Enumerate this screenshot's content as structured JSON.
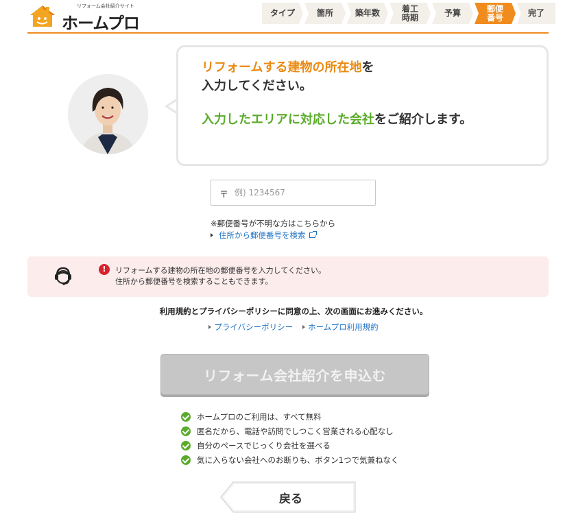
{
  "header": {
    "logo_tagline": "リフォーム会社紹介サイト",
    "logo_text": "ホームプロ",
    "steps": [
      {
        "label": "タイプ",
        "active": false
      },
      {
        "label": "箇所",
        "active": false
      },
      {
        "label": "築年数",
        "active": false
      },
      {
        "label": "着工\n時期",
        "active": false
      },
      {
        "label": "予算",
        "active": false
      },
      {
        "label": "郵便\n番号",
        "active": true
      },
      {
        "label": "完了",
        "active": false
      }
    ]
  },
  "message": {
    "line1_highlight": "リフォームする建物の所在地",
    "line1_rest": "を",
    "line2": "入力してください。",
    "line3_highlight": "入力したエリアに対応した会社",
    "line3_rest": "をご紹介します。"
  },
  "postal": {
    "mark": "〒",
    "placeholder": "例) 1234567",
    "value": "",
    "note": "※郵便番号が不明な方はこちらから",
    "search_link": "住所から郵便番号を検索"
  },
  "alert": {
    "icon": "!",
    "line1": "リフォームする建物の所在地の郵便番号を入力してください。",
    "line2": "住所から郵便番号を検索することもできます。"
  },
  "consent": {
    "text": "利用規約とプライバシーポリシーに同意の上、次の画面にお進みください。",
    "privacy_link": "プライバシーポリシー",
    "terms_link": "ホームプロ利用規約"
  },
  "submit_label": "リフォーム会社紹介を申込む",
  "benefits": [
    "ホームプロのご利用は、すべて無料",
    "匿名だから、電話や訪問でしつこく営業される心配なし",
    "自分のペースでじっくり会社を選べる",
    "気に入らない会社へのお断りも、ボタン1つで気兼ねなく"
  ],
  "back_label": "戻る",
  "colors": {
    "accent_orange": "#f08c1e",
    "highlight_green": "#5aab2a",
    "link_blue": "#1f73c4",
    "alert_bg": "#fcecec",
    "alert_red": "#d7232d"
  }
}
